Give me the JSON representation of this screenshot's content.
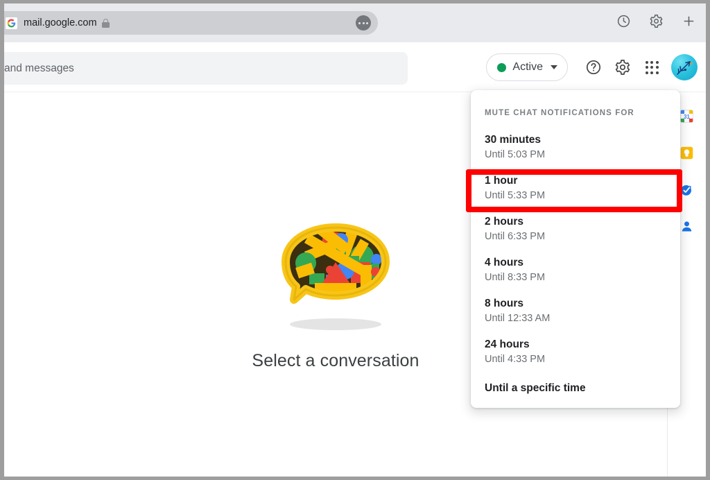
{
  "browser": {
    "url": "mail.google.com",
    "favicon": "google-g-icon",
    "lock": "lock-icon",
    "omnibox_menu": "omnibox-overflow-icon",
    "actions": [
      {
        "name": "history-icon",
        "label": "History"
      },
      {
        "name": "browser-settings-icon",
        "label": "Settings"
      },
      {
        "name": "new-tab-icon",
        "label": "New Tab"
      }
    ]
  },
  "app_header": {
    "search_text": "and messages",
    "search_placeholder": "Search chats and messages",
    "status": {
      "label": "Active",
      "dot_color": "#0b9d58",
      "caret": "chevron-down-icon"
    },
    "help_label": "Help",
    "settings_label": "Settings",
    "apps_label": "Google apps",
    "avatar_label": "Account"
  },
  "main": {
    "empty_state_title": "Select a conversation",
    "illustration": "chat-bubble-shapes-illustration"
  },
  "side_rail": {
    "items": [
      {
        "name": "google-calendar-icon",
        "label": "Calendar",
        "badge": "31"
      },
      {
        "name": "google-keep-icon",
        "label": "Keep"
      },
      {
        "name": "google-tasks-icon",
        "label": "Tasks"
      },
      {
        "name": "google-contacts-icon",
        "label": "Contacts"
      }
    ]
  },
  "mute_menu": {
    "header": "MUTE CHAT NOTIFICATIONS FOR",
    "items": [
      {
        "title": "30 minutes",
        "subtitle": "Until 5:03 PM"
      },
      {
        "title": "1 hour",
        "subtitle": "Until 5:33 PM"
      },
      {
        "title": "2 hours",
        "subtitle": "Until 6:33 PM"
      },
      {
        "title": "4 hours",
        "subtitle": "Until 8:33 PM"
      },
      {
        "title": "8 hours",
        "subtitle": "Until 12:33 AM"
      },
      {
        "title": "24 hours",
        "subtitle": "Until 4:33 PM"
      },
      {
        "title": "Until a specific time",
        "subtitle": ""
      }
    ]
  },
  "annotation": {
    "color": "#ff0000",
    "target": "1 hour"
  }
}
